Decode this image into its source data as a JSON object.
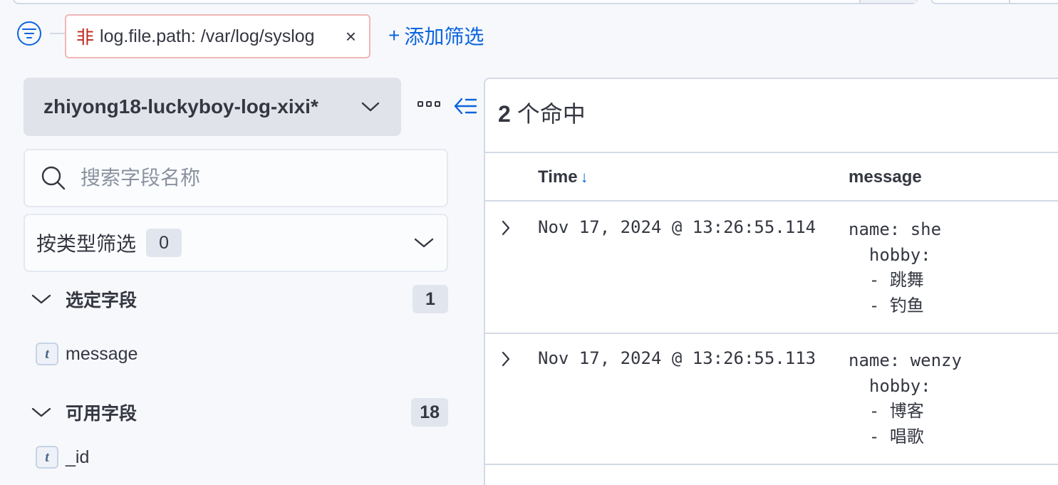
{
  "filter_bar": {
    "filter": {
      "negation_label": "非",
      "text": "log.file.path: /var/log/syslog",
      "remove_glyph": "×"
    },
    "add_filter_label": "添加筛选",
    "add_filter_glyph": "+"
  },
  "sidebar": {
    "index_pattern": "zhiyong18-luckyboy-log-xixi*",
    "search": {
      "placeholder": "搜索字段名称",
      "value": ""
    },
    "type_filter": {
      "label": "按类型筛选",
      "count": "0"
    },
    "selected_fields": {
      "title": "选定字段",
      "count": "1",
      "items": [
        {
          "type_token": "t",
          "name": "message"
        }
      ]
    },
    "available_fields": {
      "title": "可用字段",
      "count": "18",
      "items": [
        {
          "type_token": "t",
          "name": "_id"
        }
      ]
    }
  },
  "results": {
    "hits_count": "2",
    "hits_label": "个命中",
    "columns": [
      {
        "label": "Time",
        "sort_glyph": "↓"
      },
      {
        "label": "message"
      }
    ],
    "rows": [
      {
        "time": "Nov 17, 2024 @ 13:26:55.114",
        "message": "name: she\n  hobby:\n  - 跳舞\n  - 钓鱼"
      },
      {
        "time": "Nov 17, 2024 @ 13:26:55.113",
        "message": "name: wenzy\n  hobby:\n  - 博客\n  - 唱歌"
      }
    ]
  },
  "icons": {
    "filter_menu": "filter-icon",
    "index_dropdown": "chevron-down-icon",
    "more_options": "more-icon",
    "collapse_sidebar": "collapse-left-icon",
    "search": "search-icon",
    "type_dropdown": "chevron-down-icon",
    "section_toggle": "chevron-down-icon",
    "row_expand": "chevron-right-icon"
  },
  "colors": {
    "primary": "#0b64dd",
    "negation": "#bd271e",
    "filter_border": "#f1b6b6"
  }
}
